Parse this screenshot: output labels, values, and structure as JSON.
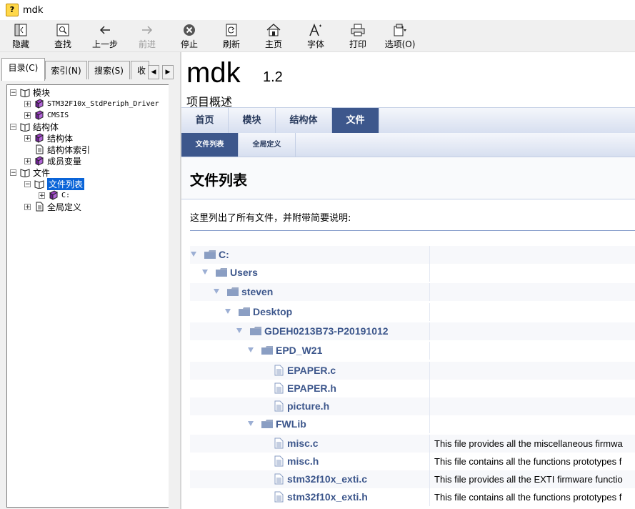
{
  "window": {
    "title": "mdk"
  },
  "toolbar": {
    "hide": "隐藏",
    "find": "查找",
    "back": "上一步",
    "forward": "前进",
    "stop": "停止",
    "refresh": "刷新",
    "home": "主页",
    "font": "字体",
    "print": "打印",
    "options": "选项(O)"
  },
  "left_tabs": {
    "contents": "目录(C)",
    "index": "索引(N)",
    "search": "搜索(S)",
    "favorites": "收"
  },
  "tree": [
    {
      "label": "模块"
    },
    {
      "label": "STM32F10x_StdPeriph_Driver"
    },
    {
      "label": "CMSIS"
    },
    {
      "label": "结构体"
    },
    {
      "label": "结构体"
    },
    {
      "label": "结构体索引"
    },
    {
      "label": "成员变量"
    },
    {
      "label": "文件"
    },
    {
      "label": "文件列表"
    },
    {
      "label": "C:"
    },
    {
      "label": "全局定义"
    }
  ],
  "project": {
    "name": "mdk",
    "number": "1.2",
    "brief": "项目概述"
  },
  "nav_tabs": [
    "首页",
    "模块",
    "结构体",
    "文件"
  ],
  "sub_tabs": [
    "文件列表",
    "全局定义"
  ],
  "page": {
    "title": "文件列表",
    "description": "这里列出了所有文件，并附带简要说明:"
  },
  "files": [
    {
      "name": "C:",
      "kind": "folder",
      "desc": ""
    },
    {
      "name": "Users",
      "kind": "folder",
      "desc": ""
    },
    {
      "name": "steven",
      "kind": "folder",
      "desc": ""
    },
    {
      "name": "Desktop",
      "kind": "folder",
      "desc": ""
    },
    {
      "name": "GDEH0213B73-P20191012",
      "kind": "folder",
      "desc": ""
    },
    {
      "name": "EPD_W21",
      "kind": "folder",
      "desc": ""
    },
    {
      "name": "EPAPER.c",
      "kind": "file",
      "desc": ""
    },
    {
      "name": "EPAPER.h",
      "kind": "file",
      "desc": ""
    },
    {
      "name": "picture.h",
      "kind": "file",
      "desc": ""
    },
    {
      "name": "FWLib",
      "kind": "folder",
      "desc": ""
    },
    {
      "name": "misc.c",
      "kind": "file",
      "desc": "This file provides all the miscellaneous firmwa"
    },
    {
      "name": "misc.h",
      "kind": "file",
      "desc": "This file contains all the functions prototypes f"
    },
    {
      "name": "stm32f10x_exti.c",
      "kind": "file",
      "desc": "This file provides all the EXTI firmware functio"
    },
    {
      "name": "stm32f10x_exti.h",
      "kind": "file",
      "desc": "This file contains all the functions prototypes f"
    }
  ],
  "colors": {
    "nav_active": "#3d578c",
    "link": "#3d578c",
    "selection": "#0a64d8"
  }
}
